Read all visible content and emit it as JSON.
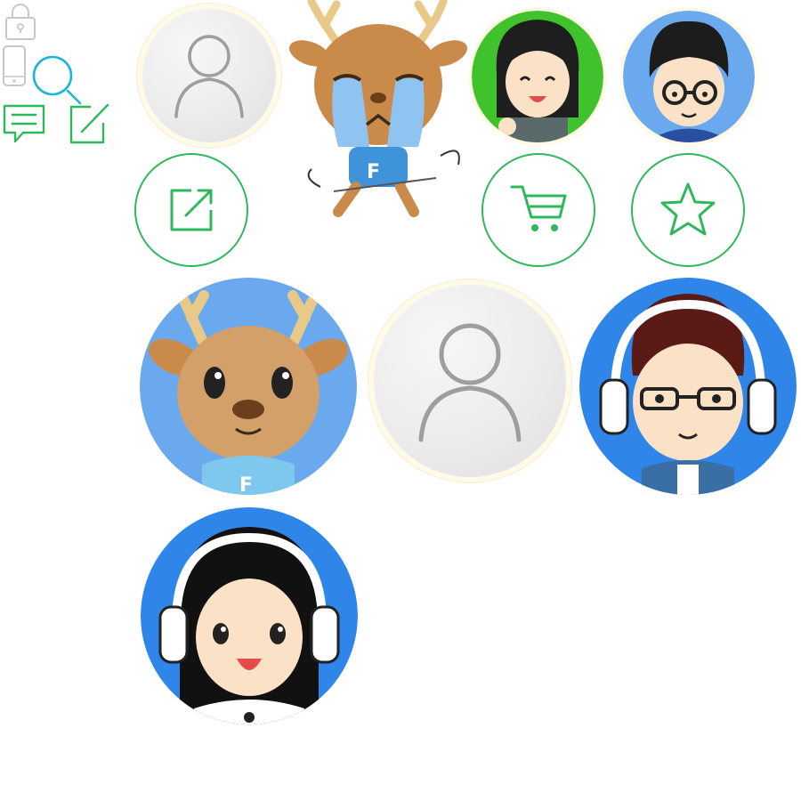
{
  "page": {},
  "icons": {
    "lock": "lock-icon",
    "phone": "phone-icon",
    "search": "search-icon",
    "comment": "comment-icon",
    "edit": "edit-icon",
    "share": "share-icon",
    "cart": "cart-icon",
    "star": "star-icon",
    "user_placeholder": "user-placeholder-icon"
  },
  "colors": {
    "accent_green": "#2eb85c",
    "accent_cyan": "#19b6d6",
    "icon_grey": "#bdbdbd",
    "avatar_blue": "#2f86e8",
    "avatar_light_blue": "#6aa9ee",
    "avatar_green": "#3fc22b",
    "placeholder_grey": "#e8e8e8"
  },
  "avatars": [
    {
      "id": "placeholder-small",
      "kind": "placeholder"
    },
    {
      "id": "crying-deer-sticker",
      "kind": "sticker"
    },
    {
      "id": "girl-avatar-green",
      "kind": "cartoon"
    },
    {
      "id": "boy-glasses-avatar-blue",
      "kind": "cartoon"
    },
    {
      "id": "deer-avatar-large",
      "kind": "cartoon"
    },
    {
      "id": "placeholder-large",
      "kind": "placeholder"
    },
    {
      "id": "boy-headphones-avatar",
      "kind": "cartoon"
    },
    {
      "id": "girl-headphones-avatar",
      "kind": "cartoon"
    }
  ],
  "buttons": [
    {
      "id": "share",
      "icon": "share-icon"
    },
    {
      "id": "cart",
      "icon": "cart-icon"
    },
    {
      "id": "star",
      "icon": "star-icon"
    }
  ]
}
